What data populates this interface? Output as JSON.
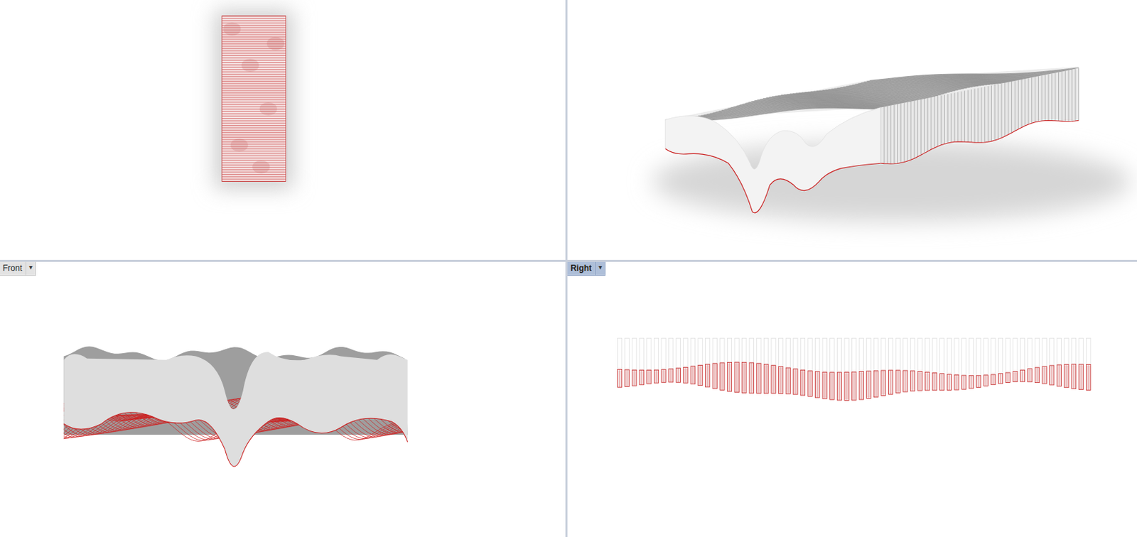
{
  "viewports": [
    {
      "kind": "top"
    },
    {
      "kind": "perspective"
    },
    {
      "kind": "front",
      "label": "Front",
      "menu_glyph": "▾",
      "selected": false
    },
    {
      "kind": "right",
      "label": "Right",
      "menu_glyph": "▾",
      "selected": true
    }
  ]
}
